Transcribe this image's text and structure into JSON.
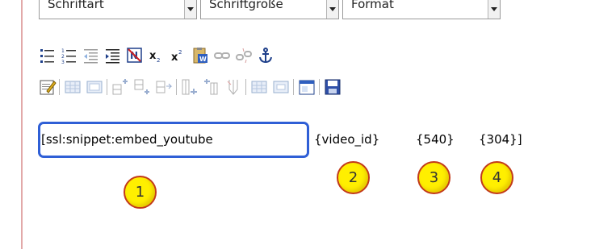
{
  "toolbar": {
    "font_dropdown": "Schriftart",
    "size_dropdown": "Schriftgröße",
    "format_dropdown": "Format"
  },
  "icons_row1": [
    "unordered-list-icon",
    "ordered-list-icon",
    "outdent-icon",
    "indent-icon",
    "remove-format-icon",
    "subscript-icon",
    "superscript-icon",
    "paste-word-icon",
    "link-icon",
    "unlink-icon",
    "anchor-icon"
  ],
  "icons_row2": [
    "edit-source-icon",
    "table-icon",
    "table-properties-icon",
    "insert-row-before-icon",
    "insert-row-after-icon",
    "delete-row-icon",
    "insert-col-before-icon",
    "insert-col-after-icon",
    "delete-col-icon",
    "merge-cells-icon",
    "split-cells-icon",
    "cell-properties-icon",
    "save-icon"
  ],
  "content": {
    "snippet": "[ssl:snippet:embed_youtube",
    "param1": "{video_id}",
    "param2": "{540}",
    "param3": "{304}]"
  },
  "callouts": [
    "1",
    "2",
    "3",
    "4"
  ],
  "colors": {
    "highlight": "#2f5fd6",
    "callout_fill": "#ffef00",
    "callout_border": "#c23a1a"
  }
}
